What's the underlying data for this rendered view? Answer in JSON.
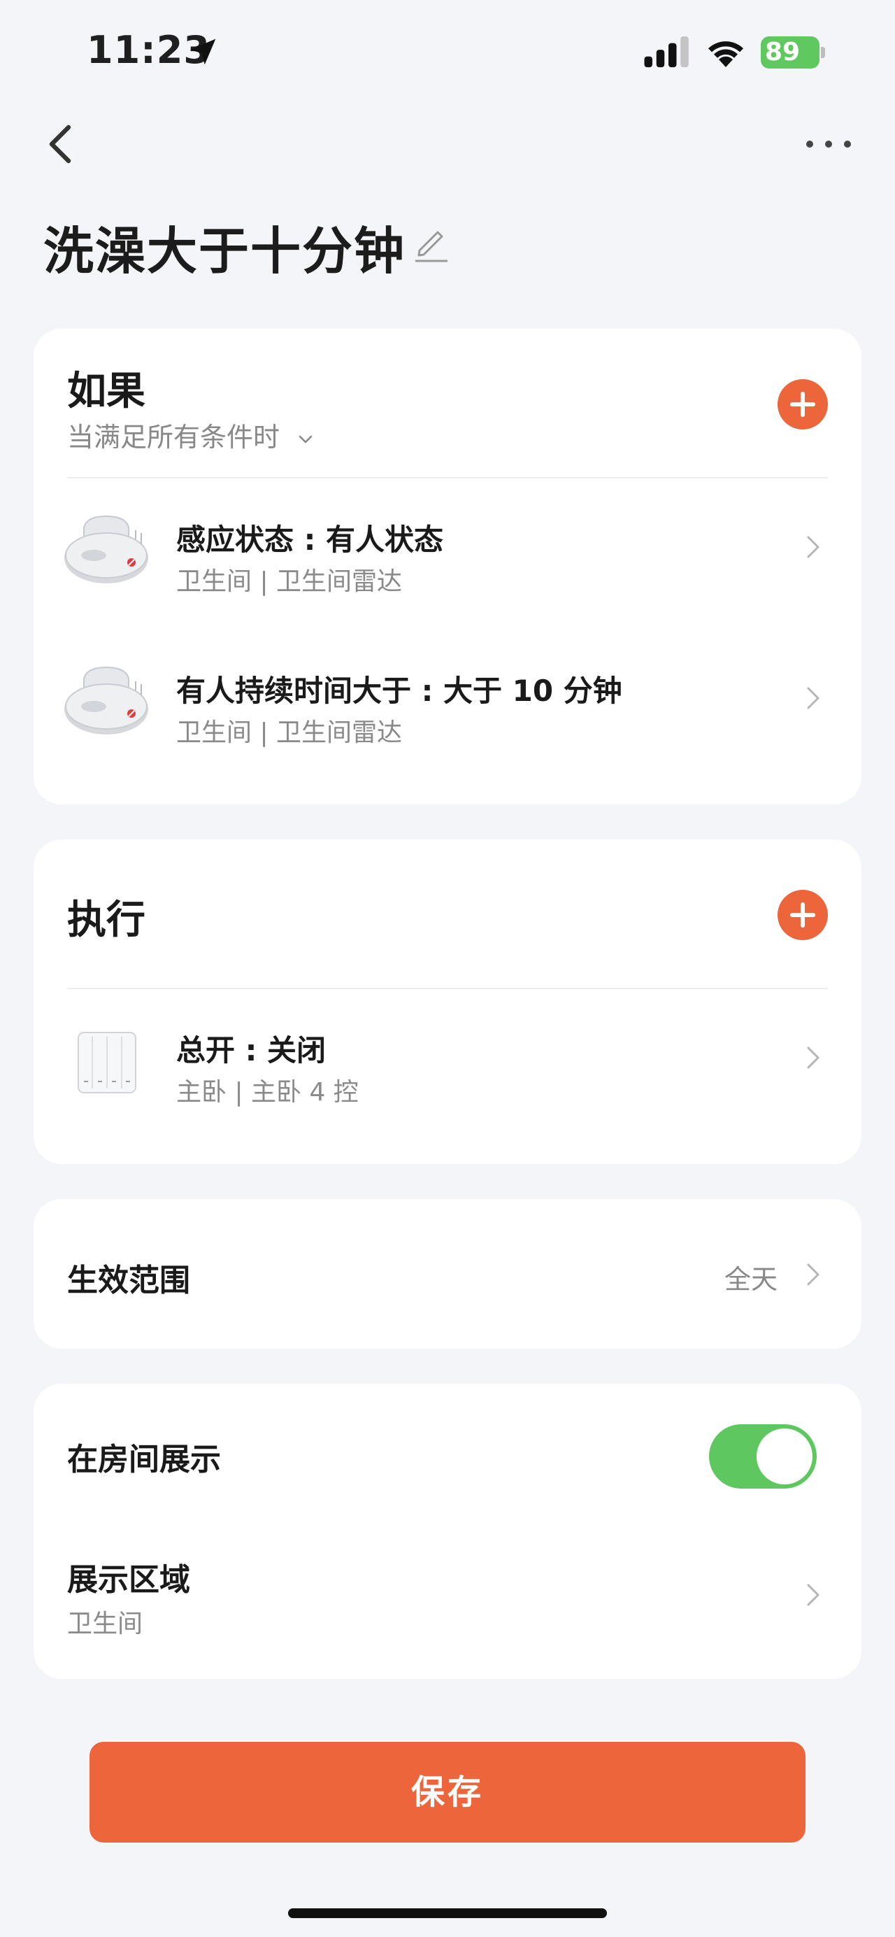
{
  "status_bar": {
    "time": "11:23",
    "battery": "89"
  },
  "page": {
    "title": "洗澡大于十分钟"
  },
  "if_section": {
    "title": "如果",
    "subtitle": "当满足所有条件时",
    "conditions": [
      {
        "title": "感应状态 : 有人状态",
        "subtitle": "卫生间 | 卫生间雷达"
      },
      {
        "title": "有人持续时间大于 : 大于 10 分钟",
        "subtitle": "卫生间 | 卫生间雷达"
      }
    ]
  },
  "do_section": {
    "title": "执行",
    "actions": [
      {
        "title": "总开 : 关闭",
        "subtitle": "主卧 | 主卧 4 控"
      }
    ]
  },
  "scope": {
    "label": "生效范围",
    "value": "全天"
  },
  "display": {
    "show_in_room_label": "在房间展示",
    "show_in_room_on": true,
    "area_label": "展示区域",
    "area_value": "卫生间"
  },
  "save_label": "保存",
  "colors": {
    "accent": "#ec653b",
    "toggle_on": "#5fc75f",
    "battery": "#5fc95f",
    "background": "#f4f5f9"
  },
  "icons": [
    "location-arrow-icon",
    "cellular-signal-icon",
    "wifi-icon",
    "battery-icon",
    "back-arrow-icon",
    "more-icon",
    "edit-pencil-icon",
    "plus-icon",
    "chevron-right-icon",
    "radar-sensor-icon",
    "wall-switch-icon"
  ]
}
